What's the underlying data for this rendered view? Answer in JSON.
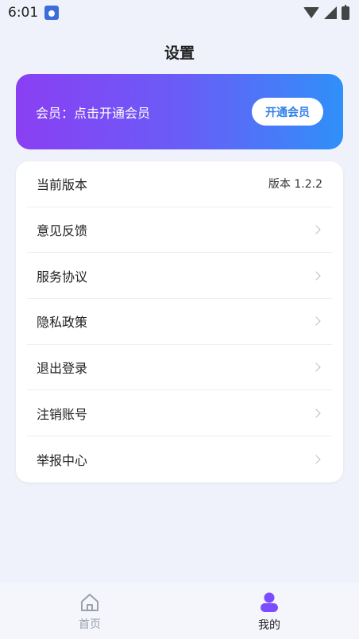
{
  "status_bar": {
    "time": "6:01",
    "icons": [
      "app-notification-icon",
      "wifi-icon",
      "signal-icon",
      "battery-icon"
    ]
  },
  "header": {
    "title": "设置"
  },
  "vip_banner": {
    "text": "会员：点击开通会员",
    "button_label": "开通会员",
    "gradient": [
      "#8a3ff3",
      "#2f90f8"
    ]
  },
  "settings": {
    "version": {
      "label": "当前版本",
      "value": "版本 1.2.2"
    },
    "items": [
      {
        "label": "意见反馈"
      },
      {
        "label": "服务协议"
      },
      {
        "label": "隐私政策"
      },
      {
        "label": "退出登录"
      },
      {
        "label": "注销账号"
      },
      {
        "label": "举报中心"
      }
    ]
  },
  "tab_bar": {
    "tabs": [
      {
        "label": "首页",
        "icon": "home-icon",
        "active": false
      },
      {
        "label": "我的",
        "icon": "user-icon",
        "active": true
      }
    ],
    "active_color": "#7c4dff"
  }
}
